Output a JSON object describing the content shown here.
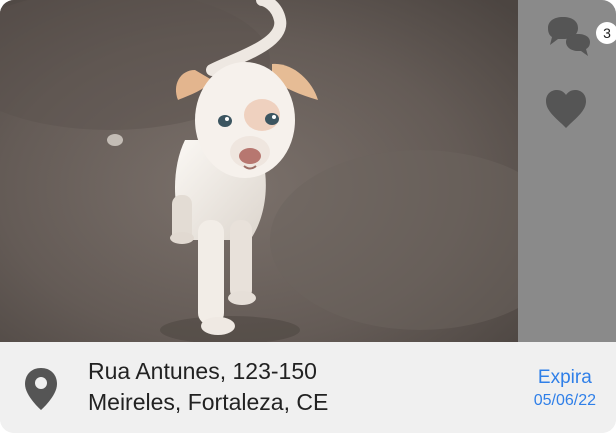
{
  "post": {
    "photo": {
      "subject": "puppy-photo"
    },
    "actions": {
      "comments_count": "3",
      "comments_icon": "chat-bubbles-icon",
      "favorite_icon": "heart-icon"
    },
    "location": {
      "icon": "map-pin-icon",
      "street": "Rua Antunes, 123-150",
      "district_city": "Meireles, Fortaleza, CE"
    },
    "expiry": {
      "label": "Expira",
      "date": "05/06/22"
    }
  },
  "colors": {
    "rail": "#8a8a8a",
    "footer": "#f0f0f0",
    "accent": "#2f7fe8",
    "icon": "#555555"
  }
}
